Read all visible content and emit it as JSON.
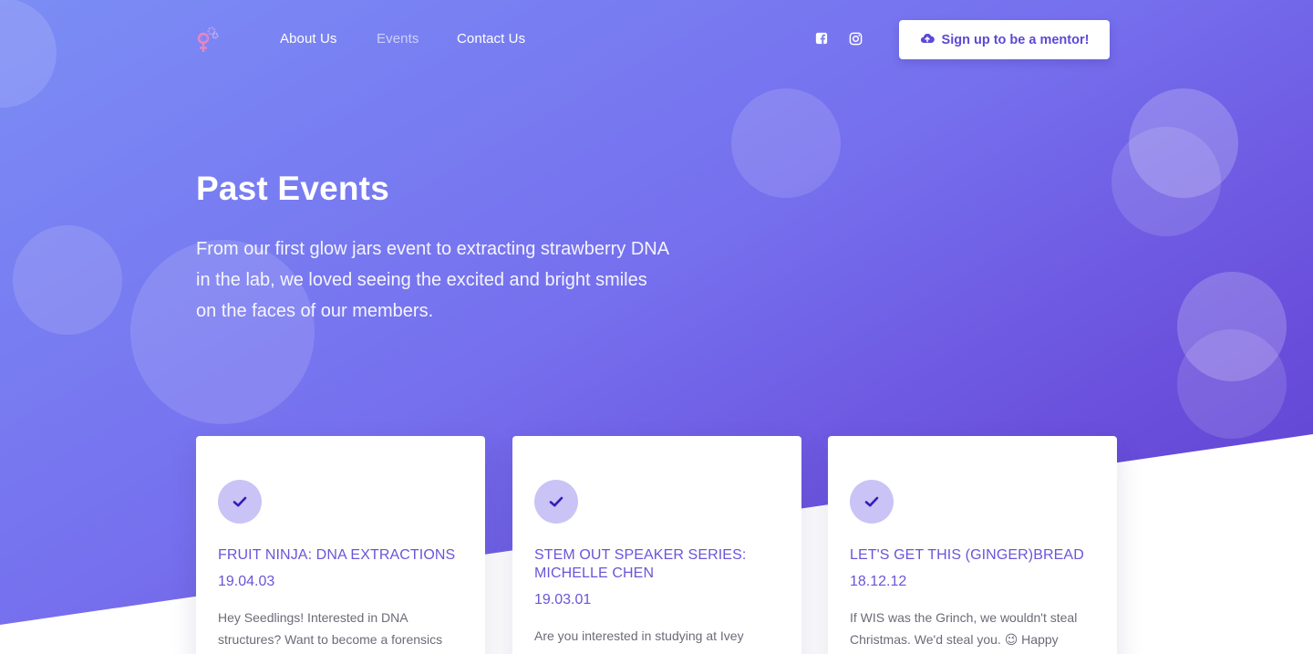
{
  "nav": {
    "logo_icon": "female-gears-logo",
    "links": [
      {
        "label": "About Us",
        "active": false
      },
      {
        "label": "Events",
        "active": true
      },
      {
        "label": "Contact Us",
        "active": false
      }
    ],
    "social": [
      {
        "icon": "facebook-icon"
      },
      {
        "icon": "instagram-icon"
      }
    ],
    "cta": {
      "label": "Sign up to be a mentor!",
      "icon": "cloud-upload-icon"
    }
  },
  "hero": {
    "title": "Past Events",
    "lead": "From our first glow jars event to extracting strawberry DNA in the lab, we loved seeing the excited and bright smiles on the faces of our members."
  },
  "events": [
    {
      "icon": "check-icon",
      "title": "FRUIT NINJA: DNA EXTRACTIONS",
      "date": "19.04.03",
      "text": "Hey Seedlings! Interested in DNA structures? Want to become a forensics"
    },
    {
      "icon": "check-icon",
      "title": "STEM OUT SPEAKER SERIES: MICHELLE CHEN",
      "date": "19.03.01",
      "text": "Are you interested in studying at Ivey"
    },
    {
      "icon": "check-icon",
      "title": "LET'S GET THIS (GINGER)BREAD",
      "date": "18.12.12",
      "text": "If WIS was the Grinch, we wouldn't steal Christmas. We'd steal you. 😉 Happy"
    }
  ],
  "colors": {
    "accent": "#6a55d8",
    "gradient_start": "#7b8df5",
    "gradient_end": "#5b3ccc",
    "check_bg": "#c9c3f6"
  }
}
